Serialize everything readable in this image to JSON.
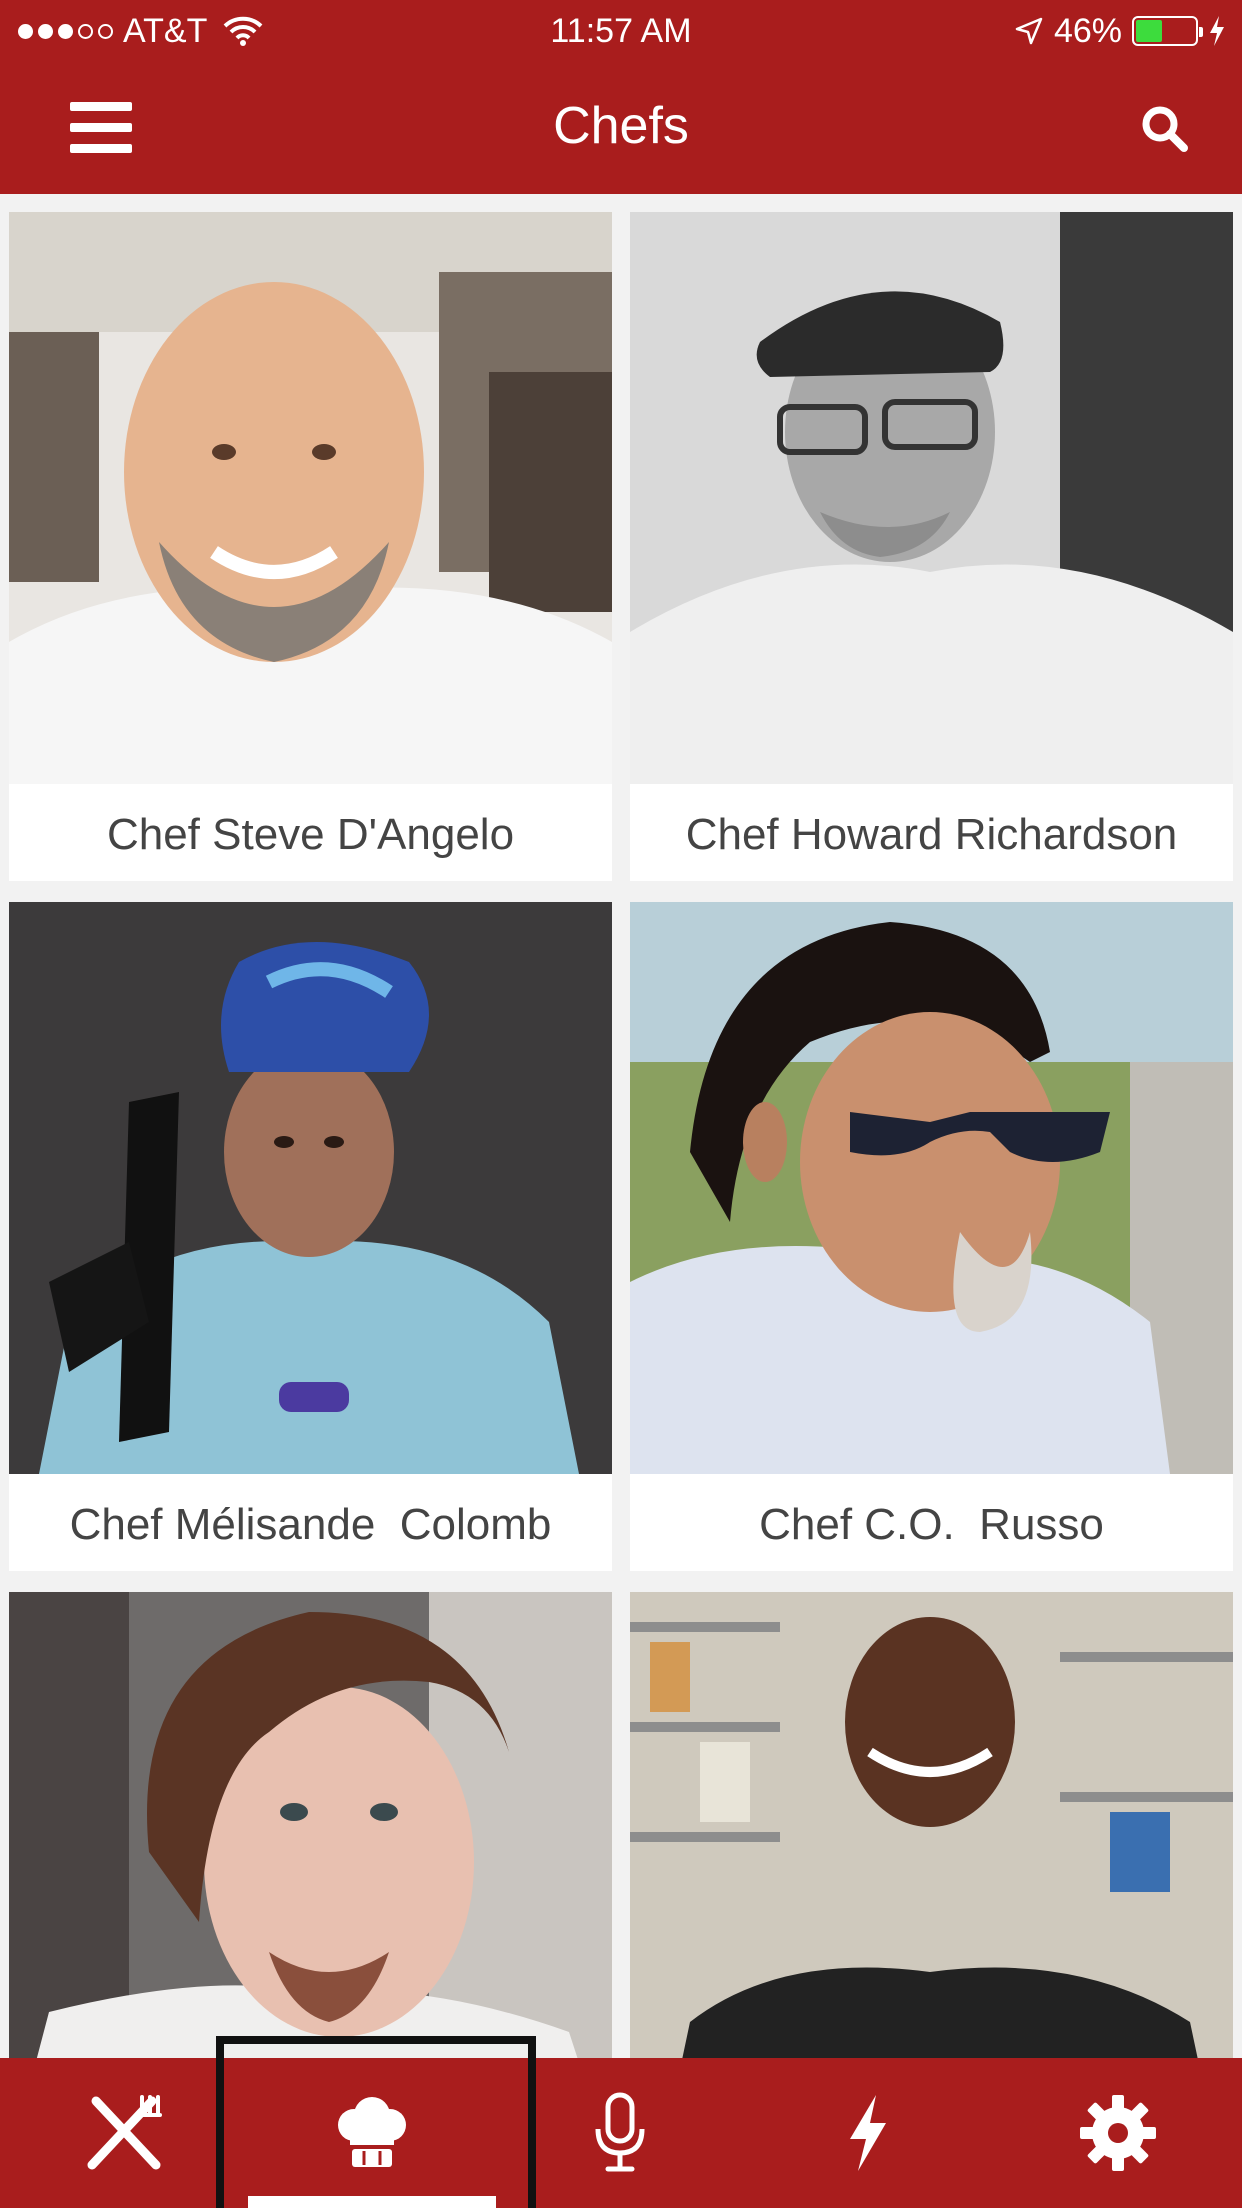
{
  "status_bar": {
    "carrier": "AT&T",
    "time": "11:57 AM",
    "battery": "46%",
    "battery_level": 0.46
  },
  "nav": {
    "title": "Chefs",
    "menu_icon": "hamburger-menu-icon",
    "search_icon": "search-icon"
  },
  "chefs": [
    {
      "name": "Chef Steve D'Angelo"
    },
    {
      "name": "Chef Howard Richardson"
    },
    {
      "name": "Chef Mélisande  Colomb"
    },
    {
      "name": "Chef C.O.  Russo"
    },
    {
      "name": ""
    },
    {
      "name": ""
    }
  ],
  "tabs": [
    {
      "icon": "fork-knife-icon",
      "selected": false
    },
    {
      "icon": "chef-hat-icon",
      "selected": true
    },
    {
      "icon": "microphone-icon",
      "selected": false
    },
    {
      "icon": "lightning-icon",
      "selected": false
    },
    {
      "icon": "gear-icon",
      "selected": false
    }
  ],
  "colors": {
    "brand": "#a91d1d",
    "background": "#f2f2f2",
    "name_text": "#444444"
  }
}
